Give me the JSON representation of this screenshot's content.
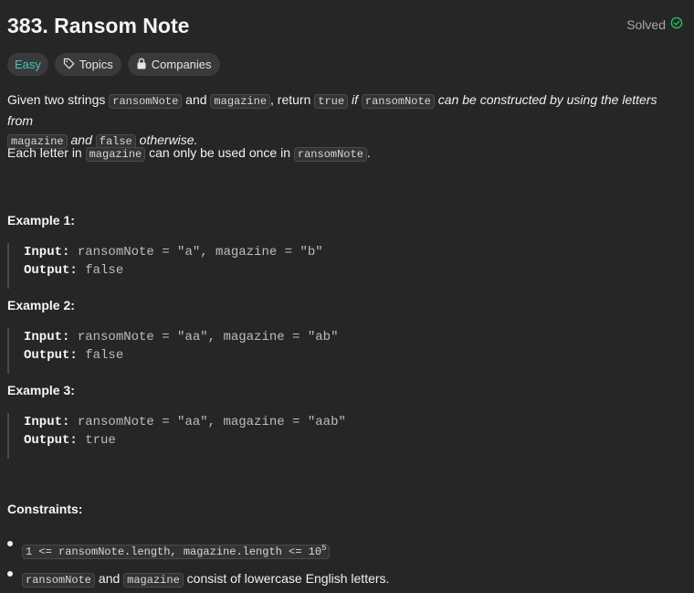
{
  "problem": {
    "title": "383. Ransom Note",
    "status": "Solved",
    "difficulty": "Easy",
    "tag_topics": "Topics",
    "tag_companies": "Companies"
  },
  "description": {
    "p1": {
      "t1": "Given two strings ",
      "c1": "ransomNote",
      "t2": " and ",
      "c2": "magazine",
      "t3": ", return ",
      "c3": "true",
      "e1": " if ",
      "c4": "ransomNote",
      "e2": " can be constructed by using the letters from",
      "c5": "magazine",
      "e3": " and ",
      "c6": "false",
      "e4": " otherwise."
    },
    "p2": {
      "t1": "Each letter in ",
      "c1": "magazine",
      "t2": " can only be used once in ",
      "c2": "ransomNote",
      "t3": "."
    }
  },
  "examples": [
    {
      "heading": "Example 1:",
      "input_label": "Input:",
      "input_value": " ransomNote = \"a\", magazine = \"b\"",
      "output_label": "Output:",
      "output_value": " false"
    },
    {
      "heading": "Example 2:",
      "input_label": "Input:",
      "input_value": " ransomNote = \"aa\", magazine = \"ab\"",
      "output_label": "Output:",
      "output_value": " false"
    },
    {
      "heading": "Example 3:",
      "input_label": "Input:",
      "input_value": " ransomNote = \"aa\", magazine = \"aab\"",
      "output_label": "Output:",
      "output_value": " true"
    }
  ],
  "constraints": {
    "heading": "Constraints:",
    "c1_code": "1 <= ransomNote.length, magazine.length <= 10",
    "c1_sup": "5",
    "c2_code1": "ransomNote",
    "c2_t1": " and ",
    "c2_code2": "magazine",
    "c2_t2": " consist of lowercase English letters."
  },
  "colors": {
    "background": "#262626",
    "easy": "#46c6c2",
    "solved_check": "#2cbb5d"
  },
  "icons": [
    "check-circle-icon",
    "tag-icon",
    "lock-icon"
  ]
}
